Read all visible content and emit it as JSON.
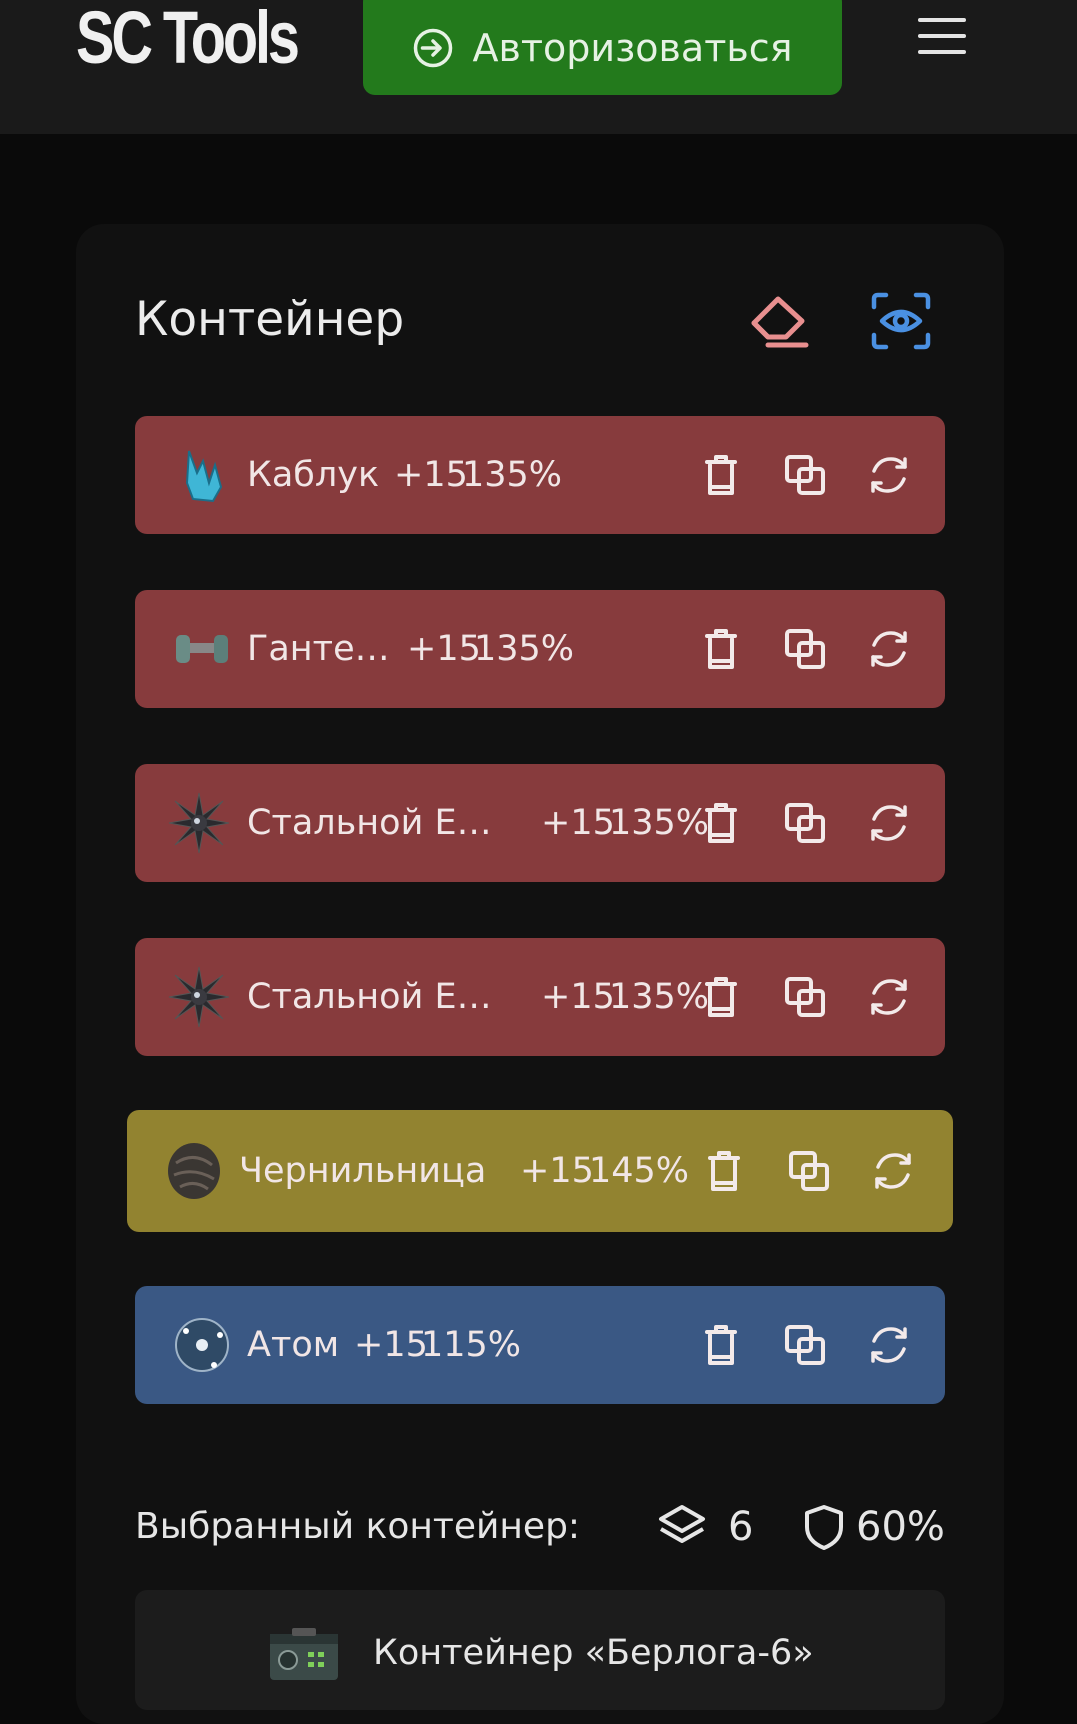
{
  "header": {
    "logo": "SC Tools",
    "login_label": "Авторизоваться"
  },
  "container_panel": {
    "title": "Контейнер",
    "items": [
      {
        "name": "Каблук",
        "level": "+15",
        "percent": "135%",
        "rarity": "red"
      },
      {
        "name": "Гантель",
        "level": "+15",
        "percent": "135%",
        "rarity": "red"
      },
      {
        "name": "Стальной Еж...",
        "level": "+15",
        "percent": "135%",
        "rarity": "red"
      },
      {
        "name": "Стальной Еж...",
        "level": "+15",
        "percent": "135%",
        "rarity": "red"
      },
      {
        "name": "Чернильница",
        "level": "+15",
        "percent": "145%",
        "rarity": "gold"
      },
      {
        "name": "Атом",
        "level": "+15",
        "percent": "115%",
        "rarity": "blue"
      }
    ],
    "selected_label": "Выбранный контейнер:",
    "slots": "6",
    "protection": "60%",
    "selected_container": "Контейнер «Берлога-6»"
  },
  "colors": {
    "red": "#873b3d",
    "gold": "#928330",
    "blue": "#3a5884",
    "login": "#237a1c",
    "eraser": "#e88f8f",
    "eye": "#4a90e2"
  }
}
